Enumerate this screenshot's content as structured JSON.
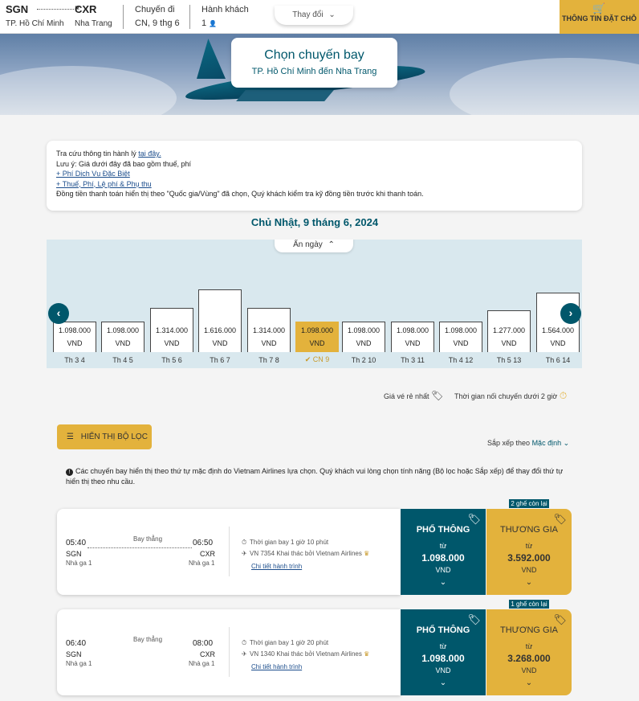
{
  "topbar": {
    "from_code": "SGN",
    "from_city": "TP. Hồ Chí Minh",
    "to_code": "CXR",
    "to_city": "Nha Trang",
    "trip_label": "Chuyến đi",
    "trip_date": "CN, 9 thg 6",
    "pax_label": "Hành khách",
    "pax_count": "1",
    "change_label": "Thay đổi",
    "cart_label": "THÔNG TIN ĐẶT CHỖ"
  },
  "hero": {
    "title": "Chọn chuyến bay",
    "subtitle": "TP. Hồ Chí Minh đến Nha Trang"
  },
  "info": {
    "baggage_prefix": "Tra cứu thông tin hành lý",
    "baggage_link": "tại đây.",
    "note": "Lưu ý: Giá dưới đây đã bao gồm thuế, phí",
    "link1": "+ Phí Dịch Vụ Đặc Biệt",
    "link2": "+ Thuế, Phí, Lệ phí & Phụ thu",
    "currency_note": "Đồng tiền thanh toán hiển thị theo \"Quốc gia/Vùng\" đã chọn, Quý khách kiểm tra kỹ đồng tiền trước khi thanh toán."
  },
  "date_title": "Chủ Nhật, 9 tháng 6, 2024",
  "calendar": {
    "hide_label": "Ẩn ngày",
    "currency": "VND",
    "days": [
      {
        "label": "Th 3 4",
        "price": "1.098.000",
        "value": 1098000
      },
      {
        "label": "Th 4 5",
        "price": "1.098.000",
        "value": 1098000
      },
      {
        "label": "Th 5 6",
        "price": "1.314.000",
        "value": 1314000
      },
      {
        "label": "Th 6 7",
        "price": "1.616.000",
        "value": 1616000
      },
      {
        "label": "Th 7 8",
        "price": "1.314.000",
        "value": 1314000
      },
      {
        "label": "CN 9",
        "price": "1.098.000",
        "value": 1098000,
        "selected": true
      },
      {
        "label": "Th 2 10",
        "price": "1.098.000",
        "value": 1098000
      },
      {
        "label": "Th 3 11",
        "price": "1.098.000",
        "value": 1098000
      },
      {
        "label": "Th 4 12",
        "price": "1.098.000",
        "value": 1098000
      },
      {
        "label": "Th 5 13",
        "price": "1.277.000",
        "value": 1277000
      },
      {
        "label": "Th 6 14",
        "price": "1.564.000",
        "value": 1564000
      }
    ]
  },
  "legend": {
    "cheapest": "Giá vé rẻ nhất",
    "connection": "Thời gian nối chuyến dưới 2 giờ"
  },
  "filter_label": "HIỂN THỊ BỘ LỌC",
  "sort": {
    "label": "Sắp xếp theo",
    "value": "Mặc định"
  },
  "notice": "Các chuyến bay hiển thị theo thứ tự mặc định do Vietnam Airlines lựa chọn. Quý khách vui lòng chọn tính năng (Bộ lọc hoặc Sắp xếp) để thay đổi thứ tự hiển thị theo nhu cầu.",
  "flights": [
    {
      "dep_time": "05:40",
      "arr_time": "06:50",
      "dep_code": "SGN",
      "arr_code": "CXR",
      "dep_terminal": "Nhà ga 1",
      "arr_terminal": "Nhà ga 1",
      "type": "Bay thẳng",
      "duration": "Thời gian bay 1 giờ 10 phút",
      "flight_no": "VN 7354 Khai thác bởi Vietnam Airlines",
      "detail_link": "Chi tiết hành trình",
      "seat_badge": "2 ghế còn lại",
      "economy": {
        "name": "PHỔ THÔNG",
        "from": "từ",
        "price": "1.098.000",
        "currency": "VND"
      },
      "business": {
        "name": "THƯƠNG GIA",
        "from": "từ",
        "price": "3.592.000",
        "currency": "VND"
      }
    },
    {
      "dep_time": "06:40",
      "arr_time": "08:00",
      "dep_code": "SGN",
      "arr_code": "CXR",
      "dep_terminal": "Nhà ga 1",
      "arr_terminal": "Nhà ga 1",
      "type": "Bay thẳng",
      "duration": "Thời gian bay 1 giờ 20 phút",
      "flight_no": "VN 1340 Khai thác bởi Vietnam Airlines",
      "detail_link": "Chi tiết hành trình",
      "seat_badge": "1 ghế còn lại",
      "economy": {
        "name": "PHỔ THÔNG",
        "from": "từ",
        "price": "1.098.000",
        "currency": "VND"
      },
      "business": {
        "name": "THƯƠNG GIA",
        "from": "từ",
        "price": "3.268.000",
        "currency": "VND"
      }
    }
  ],
  "colors": {
    "brand_teal": "#00576b",
    "brand_gold": "#e3b23c"
  }
}
